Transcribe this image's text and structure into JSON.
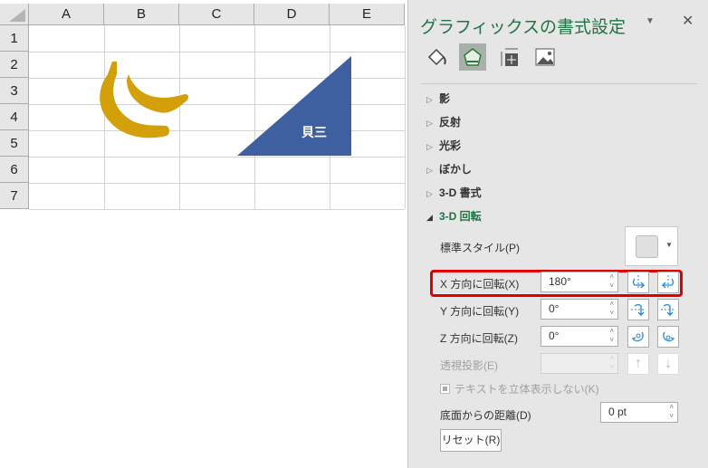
{
  "sheet": {
    "columns": [
      "A",
      "B",
      "C",
      "D",
      "E"
    ],
    "rows": [
      "1",
      "2",
      "3",
      "4",
      "5",
      "6",
      "7"
    ],
    "shape_text": "貝三",
    "triangle_color": "#3f60a0",
    "banana_color": "#d4a00a"
  },
  "panel": {
    "title": "グラフィックスの書式設定",
    "tabs": [
      "fill-line-icon",
      "effects-icon",
      "size-properties-icon",
      "picture-icon"
    ],
    "sections": [
      "影",
      "反射",
      "光彩",
      "ぼかし",
      "3-D 書式",
      "3-D 回転"
    ],
    "preset_label": "標準スタイル(P)",
    "x_label": "X 方向に回転(X)",
    "x_value": "180°",
    "y_label": "Y 方向に回転(Y)",
    "y_value": "0°",
    "z_label": "Z 方向に回転(Z)",
    "z_value": "0°",
    "perspective_label": "透視投影(E)",
    "perspective_value": "",
    "keep_text_flat_label": "テキストを立体表示しない(K)",
    "distance_label": "底面からの距離(D)",
    "distance_value": "0 pt",
    "reset_label": "リセット(R)",
    "accent": "#217346",
    "highlight": "#e00000"
  }
}
